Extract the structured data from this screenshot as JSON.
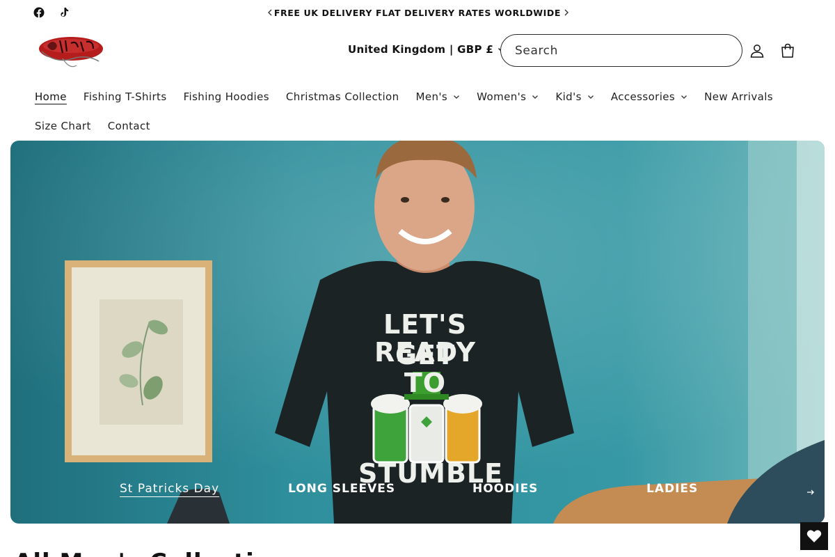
{
  "announcement": {
    "text": "FREE UK DELIVERY FLAT DELIVERY RATES WORLDWIDE",
    "social": [
      "facebook-icon",
      "tiktok-icon"
    ]
  },
  "header": {
    "logo_alt": "DarkWear logo",
    "country": "United Kingdom | GBP £",
    "search_placeholder": "Search"
  },
  "nav": {
    "row1": [
      {
        "label": "Home",
        "dropdown": false,
        "active": true
      },
      {
        "label": "Fishing T-Shirts",
        "dropdown": false
      },
      {
        "label": "Fishing Hoodies",
        "dropdown": false
      },
      {
        "label": "Christmas Collection",
        "dropdown": false
      },
      {
        "label": "Men's",
        "dropdown": true
      },
      {
        "label": "Women's",
        "dropdown": true
      },
      {
        "label": "Kid's",
        "dropdown": true
      },
      {
        "label": "Accessories",
        "dropdown": true
      },
      {
        "label": "New Arrivals",
        "dropdown": false
      }
    ],
    "row2": [
      {
        "label": "Size Chart",
        "dropdown": false
      },
      {
        "label": "Contact",
        "dropdown": false
      }
    ]
  },
  "hero": {
    "shirt_text_1": "LET'S GET",
    "shirt_text_2": "READY TO",
    "shirt_text_3": "STUMBLE",
    "tabs": [
      {
        "label": "St Patricks Day",
        "active": true
      },
      {
        "label": "LONG SLEEVES"
      },
      {
        "label": "HOODIES"
      },
      {
        "label": "LADIES"
      }
    ]
  },
  "next_section": {
    "heading": "All Men's Collection"
  },
  "colors": {
    "hero_teal": "#2e8c98",
    "text": "#121212",
    "wishlist_bg": "#111111"
  }
}
